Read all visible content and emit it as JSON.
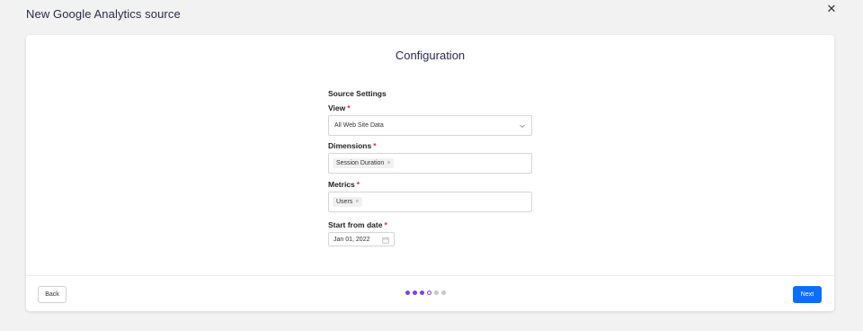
{
  "header": {
    "title": "New Google Analytics source"
  },
  "card": {
    "title": "Configuration"
  },
  "form": {
    "section_title": "Source Settings",
    "required_mark": "*",
    "view": {
      "label": "View",
      "value": "All Web Site Data"
    },
    "dimensions": {
      "label": "Dimensions",
      "tags": [
        "Session Duration"
      ]
    },
    "metrics": {
      "label": "Metrics",
      "tags": [
        "Users"
      ]
    },
    "start_date": {
      "label": "Start from date",
      "value": "Jan 01, 2022"
    }
  },
  "footer": {
    "back_label": "Back",
    "next_label": "Next",
    "steps": [
      "done",
      "done",
      "done",
      "current",
      "todo",
      "todo"
    ]
  },
  "icons": {
    "close": "close-icon",
    "remove": "×"
  },
  "colors": {
    "accent": "#0d6efd",
    "step_done": "#7a3ff2",
    "required": "#d92b2b"
  }
}
